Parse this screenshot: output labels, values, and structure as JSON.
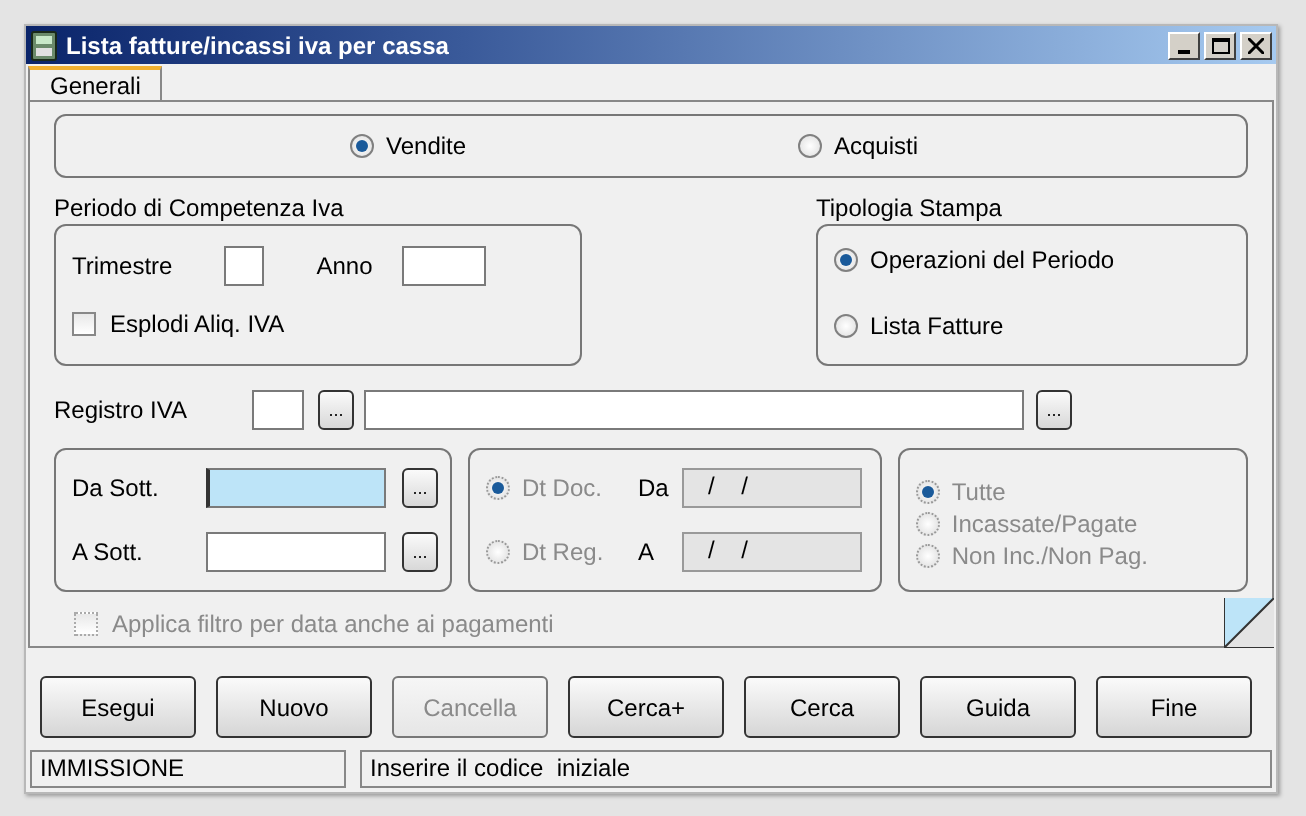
{
  "window": {
    "title": "Lista fatture/incassi iva per cassa"
  },
  "tabs": [
    {
      "label": "Generali",
      "selected": true
    }
  ],
  "tipo": {
    "options": [
      {
        "label": "Vendite",
        "selected": true
      },
      {
        "label": "Acquisti",
        "selected": false
      }
    ]
  },
  "periodo": {
    "title": "Periodo di Competenza Iva",
    "trimestre": {
      "label": "Trimestre"
    },
    "anno": {
      "label": "Anno"
    },
    "esplodi": {
      "label": "Esplodi Aliq. IVA",
      "checked": false
    }
  },
  "tipologia": {
    "title": "Tipologia Stampa",
    "options": [
      {
        "label": "Operazioni del Periodo",
        "selected": true
      },
      {
        "label": "Lista Fatture",
        "selected": false
      }
    ]
  },
  "registro": {
    "label": "Registro IVA",
    "code_button": "...",
    "description_button": "..."
  },
  "sottoconti": [
    {
      "label": "Da Sott.",
      "focused": true,
      "button": "..."
    },
    {
      "label": "A Sott.",
      "focused": false,
      "button": "..."
    }
  ],
  "date_filter": {
    "disabled": true,
    "rows": [
      {
        "option": "Dt Doc.",
        "selected": true,
        "range_label": "Da",
        "value": "/    /"
      },
      {
        "option": "Dt Reg.",
        "selected": false,
        "range_label": "A",
        "value": "/    /"
      }
    ]
  },
  "stato": {
    "disabled": true,
    "options": [
      {
        "label": "Tutte",
        "selected": true
      },
      {
        "label": "Incassate/Pagate",
        "selected": false
      },
      {
        "label": "Non Inc./Non Pag.",
        "selected": false
      }
    ]
  },
  "applica": {
    "label": "Applica filtro per data anche ai pagamenti",
    "checked": false,
    "disabled": true
  },
  "buttons": [
    {
      "label": "Esegui",
      "disabled": false
    },
    {
      "label": "Nuovo",
      "disabled": false
    },
    {
      "label": "Cancella",
      "disabled": true
    },
    {
      "label": "Cerca+",
      "disabled": false
    },
    {
      "label": "Cerca",
      "disabled": false
    },
    {
      "label": "Guida",
      "disabled": false
    },
    {
      "label": "Fine",
      "disabled": false
    }
  ],
  "status_bar": [
    "IMMISSIONE",
    "Inserire il codice  iniziale"
  ]
}
